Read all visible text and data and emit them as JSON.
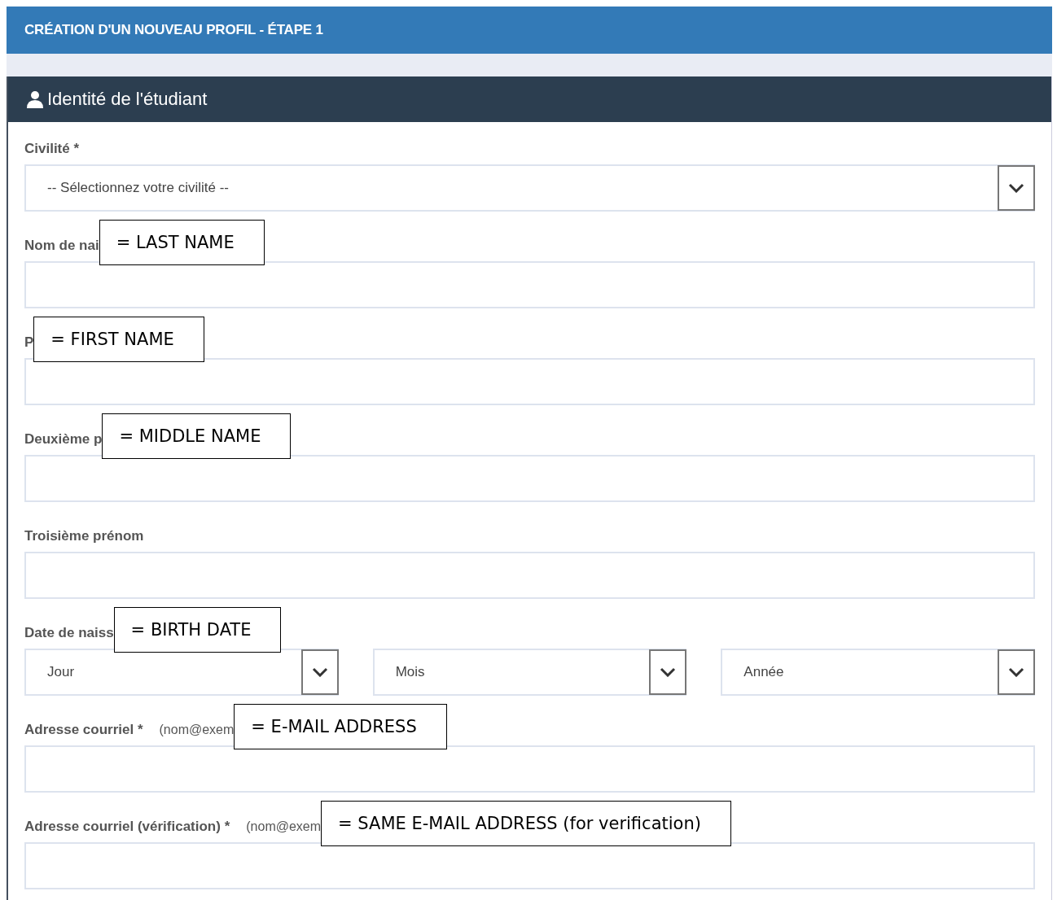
{
  "header": {
    "title": "CRÉATION D'UN NOUVEAU PROFIL - ÉTAPE 1"
  },
  "panel": {
    "title": "Identité de l'étudiant"
  },
  "fields": [
    {
      "kind": "select",
      "label": "Civilité *",
      "value": "-- Sélectionnez votre civilité --"
    },
    {
      "kind": "text",
      "label": "Nom de nai",
      "annotation": "= LAST NAME"
    },
    {
      "kind": "text",
      "label": "P",
      "annotation": "= FIRST NAME"
    },
    {
      "kind": "text",
      "label": "Deuxième p",
      "annotation": "= MIDDLE NAME"
    },
    {
      "kind": "text",
      "label": "Troisième prénom"
    },
    {
      "kind": "date",
      "label": "Date de naiss",
      "annotation": "= BIRTH DATE",
      "selects": [
        "Jour",
        "Mois",
        "Année"
      ]
    },
    {
      "kind": "text",
      "label": "Adresse courriel *",
      "hint": "(nom@exem",
      "annotation": "= E-MAIL ADDRESS"
    },
    {
      "kind": "text",
      "label": "Adresse courriel (vérification) *",
      "hint": "(nom@exem",
      "annotation": "= SAME E-MAIL ADDRESS (for verification)"
    }
  ]
}
